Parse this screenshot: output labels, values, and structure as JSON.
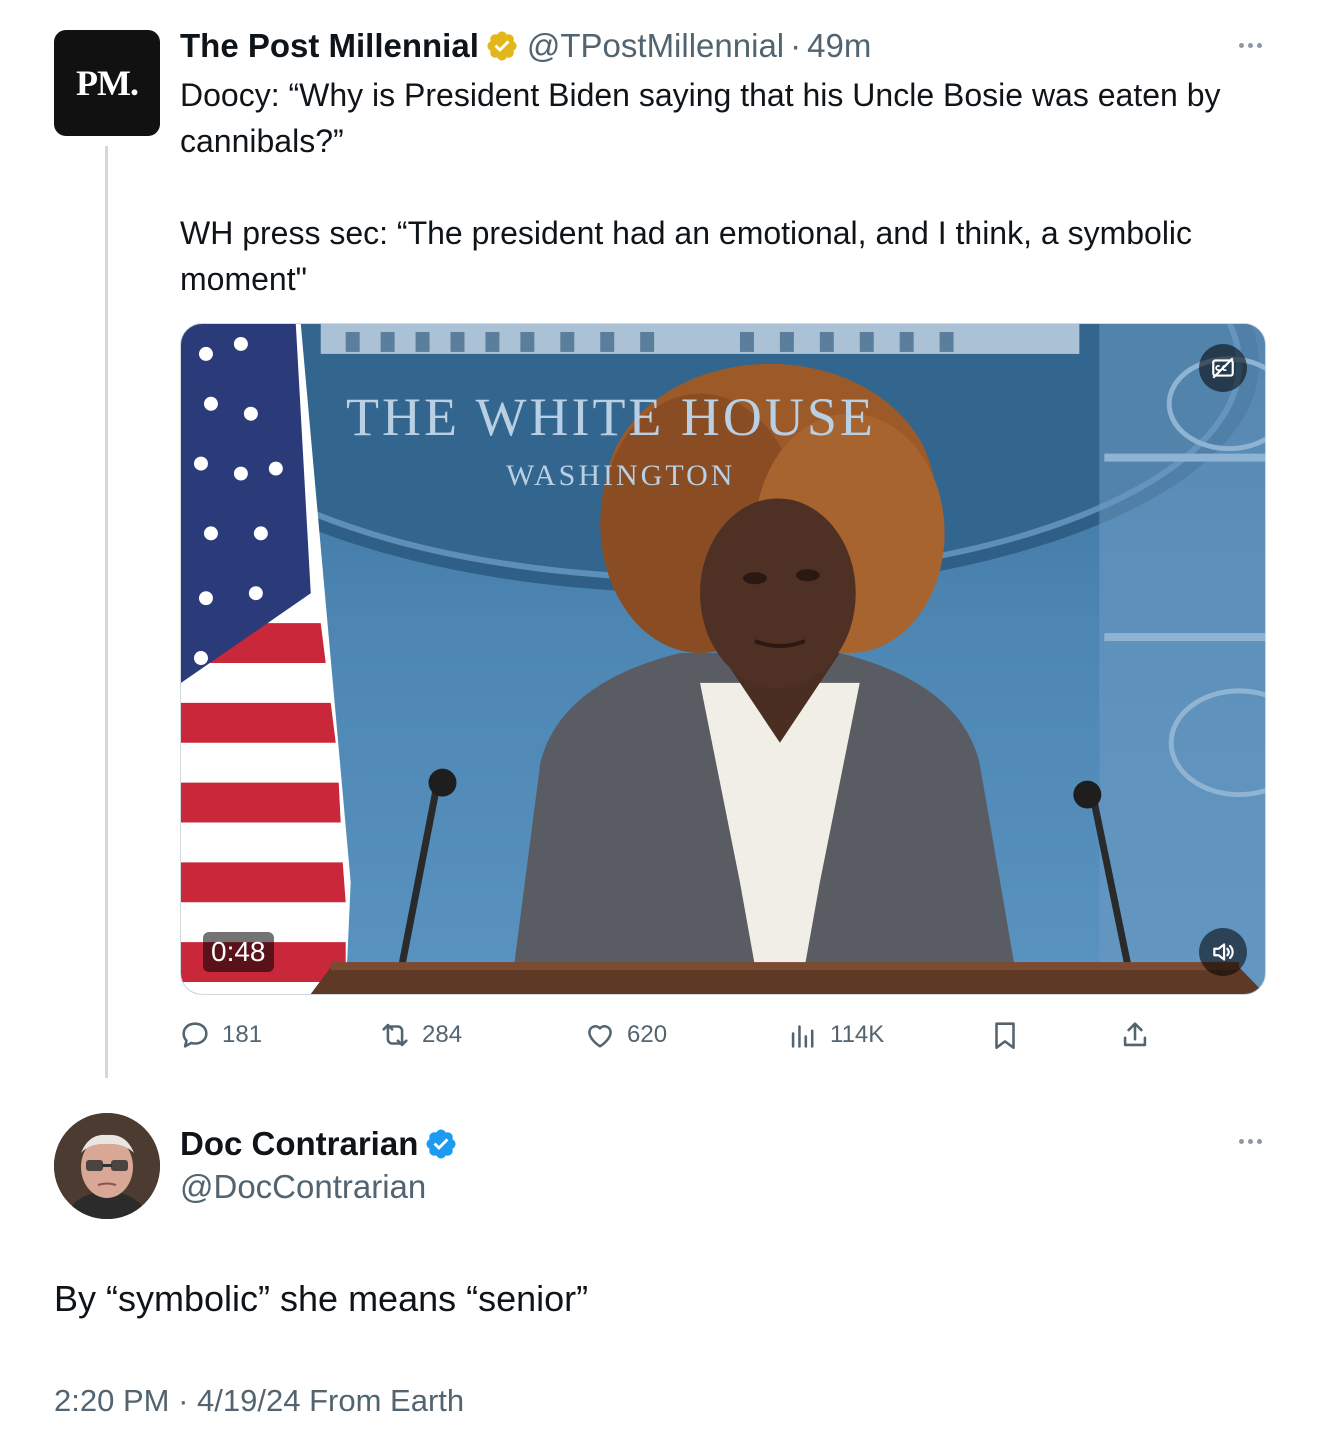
{
  "tweet": {
    "author_name": "The Post Millennial",
    "avatar_text": "PM.",
    "handle": "@TPostMillennial",
    "separator": "·",
    "time_ago": "49m",
    "text_line1": "Doocy: “Why is President Biden saying that his Uncle Bosie was eaten by cannibals?”",
    "text_line2": "WH press sec: “The president had an emotional, and I think, a symbolic moment\"",
    "badge_color": "#e2b719",
    "media": {
      "duration": "0:48",
      "seal_line1": "THE WHITE HOUSE",
      "seal_line2": "WASHINGTON"
    },
    "stats": {
      "replies": "181",
      "reposts": "284",
      "likes": "620",
      "views": "114K"
    }
  },
  "reply": {
    "author_name": "Doc Contrarian",
    "handle": "@DocContrarian",
    "badge_color": "#1d9bf0",
    "text": "By “symbolic” she means “senior”",
    "timestamp": "2:20 PM",
    "separator": "·",
    "date": "4/19/24",
    "source": "From Earth"
  }
}
